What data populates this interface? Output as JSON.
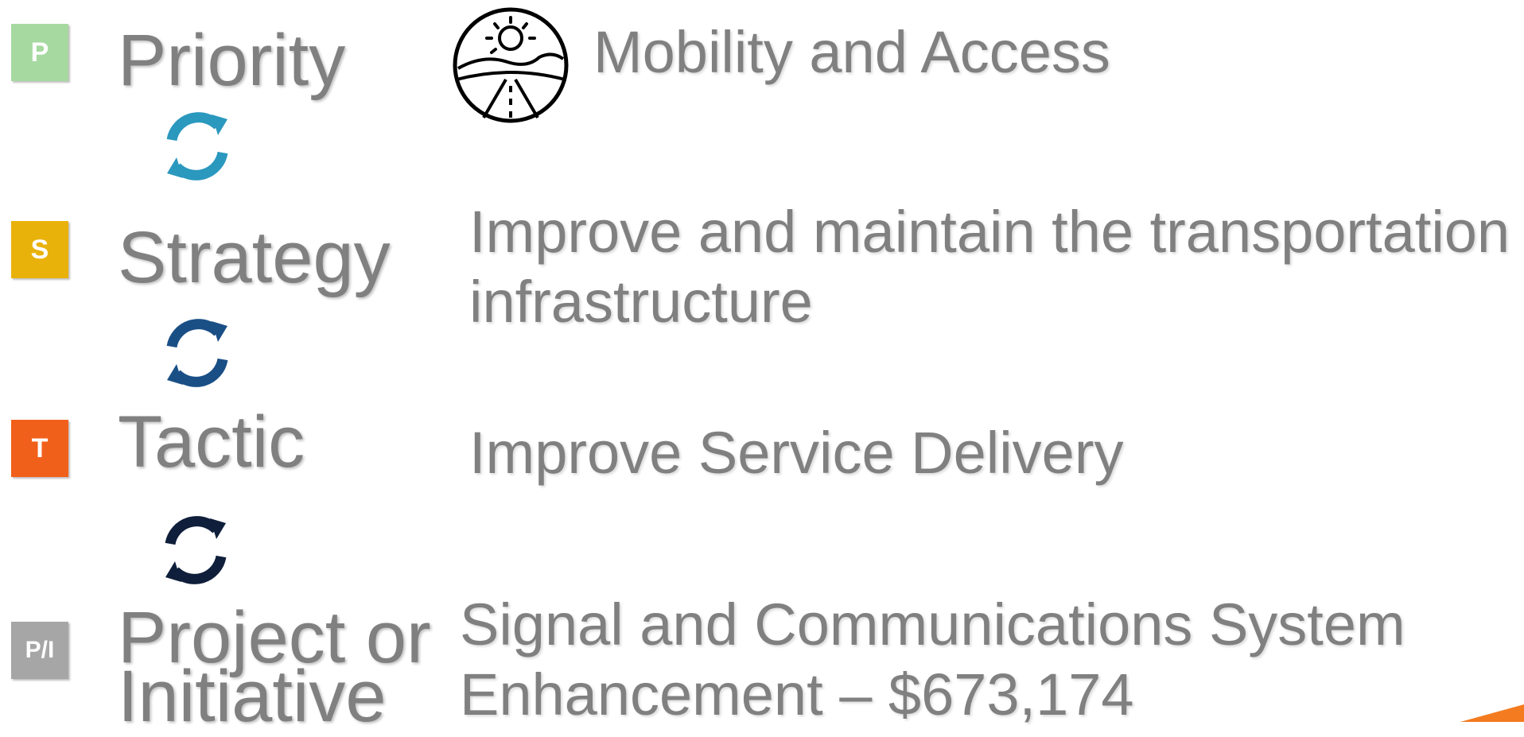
{
  "levels": {
    "priority": {
      "badge": "P",
      "label": "Priority",
      "color": "#a6d9a0"
    },
    "strategy": {
      "badge": "S",
      "label": "Strategy",
      "color": "#e9b20b"
    },
    "tactic": {
      "badge": "T",
      "label": "Tactic",
      "color": "#f1601a"
    },
    "project": {
      "badge": "P/I",
      "label_line1": "Project or",
      "label_line2": "Initiative",
      "color": "#a6a6a6"
    }
  },
  "values": {
    "priority": "Mobility and Access",
    "strategy_line1": "Improve and maintain the transportation",
    "strategy_line2": "infrastructure",
    "tactic": "Improve Service Delivery",
    "project_line1": "Signal and Communications System",
    "project_line2": "Enhancement – $673,174"
  },
  "cycle_colors": [
    "#2b98be",
    "#1a4f86",
    "#0f1e3a"
  ],
  "icons": {
    "priority_icon": "road-landscape-sun-icon",
    "cycle_icon": "refresh-cycle-icon"
  },
  "accent_color": "#f47b20"
}
